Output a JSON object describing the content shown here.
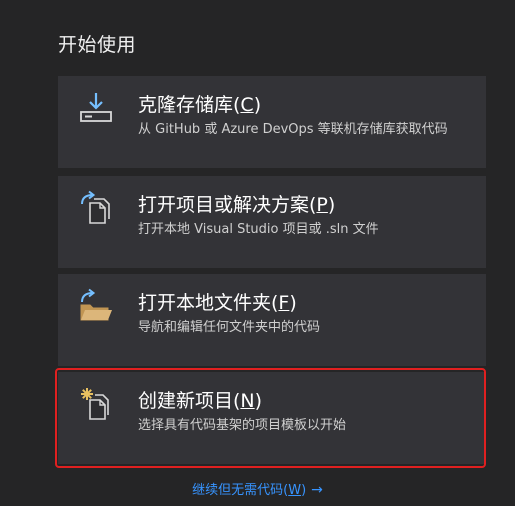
{
  "section_title": "开始使用",
  "cards": [
    {
      "title_prefix": "克隆存储库(",
      "accel": "C",
      "title_suffix": ")",
      "description": "从 GitHub 或 Azure DevOps 等联机存储库获取代码",
      "icon": "clone-download-icon"
    },
    {
      "title_prefix": "打开项目或解决方案(",
      "accel": "P",
      "title_suffix": ")",
      "description": "打开本地 Visual Studio 项目或 .sln 文件",
      "icon": "open-project-icon"
    },
    {
      "title_prefix": "打开本地文件夹(",
      "accel": "F",
      "title_suffix": ")",
      "description": "导航和编辑任何文件夹中的代码",
      "icon": "open-folder-icon"
    },
    {
      "title_prefix": "创建新项目(",
      "accel": "N",
      "title_suffix": ")",
      "description": "选择具有代码基架的项目模板以开始",
      "icon": "new-project-icon"
    }
  ],
  "continue_link": {
    "text_prefix": "继续但无需代码(",
    "accel": "W",
    "text_suffix": ")",
    "arrow": "→"
  },
  "colors": {
    "background": "#252526",
    "card": "#333337",
    "link": "#3794ff",
    "highlight": "#e02020"
  }
}
